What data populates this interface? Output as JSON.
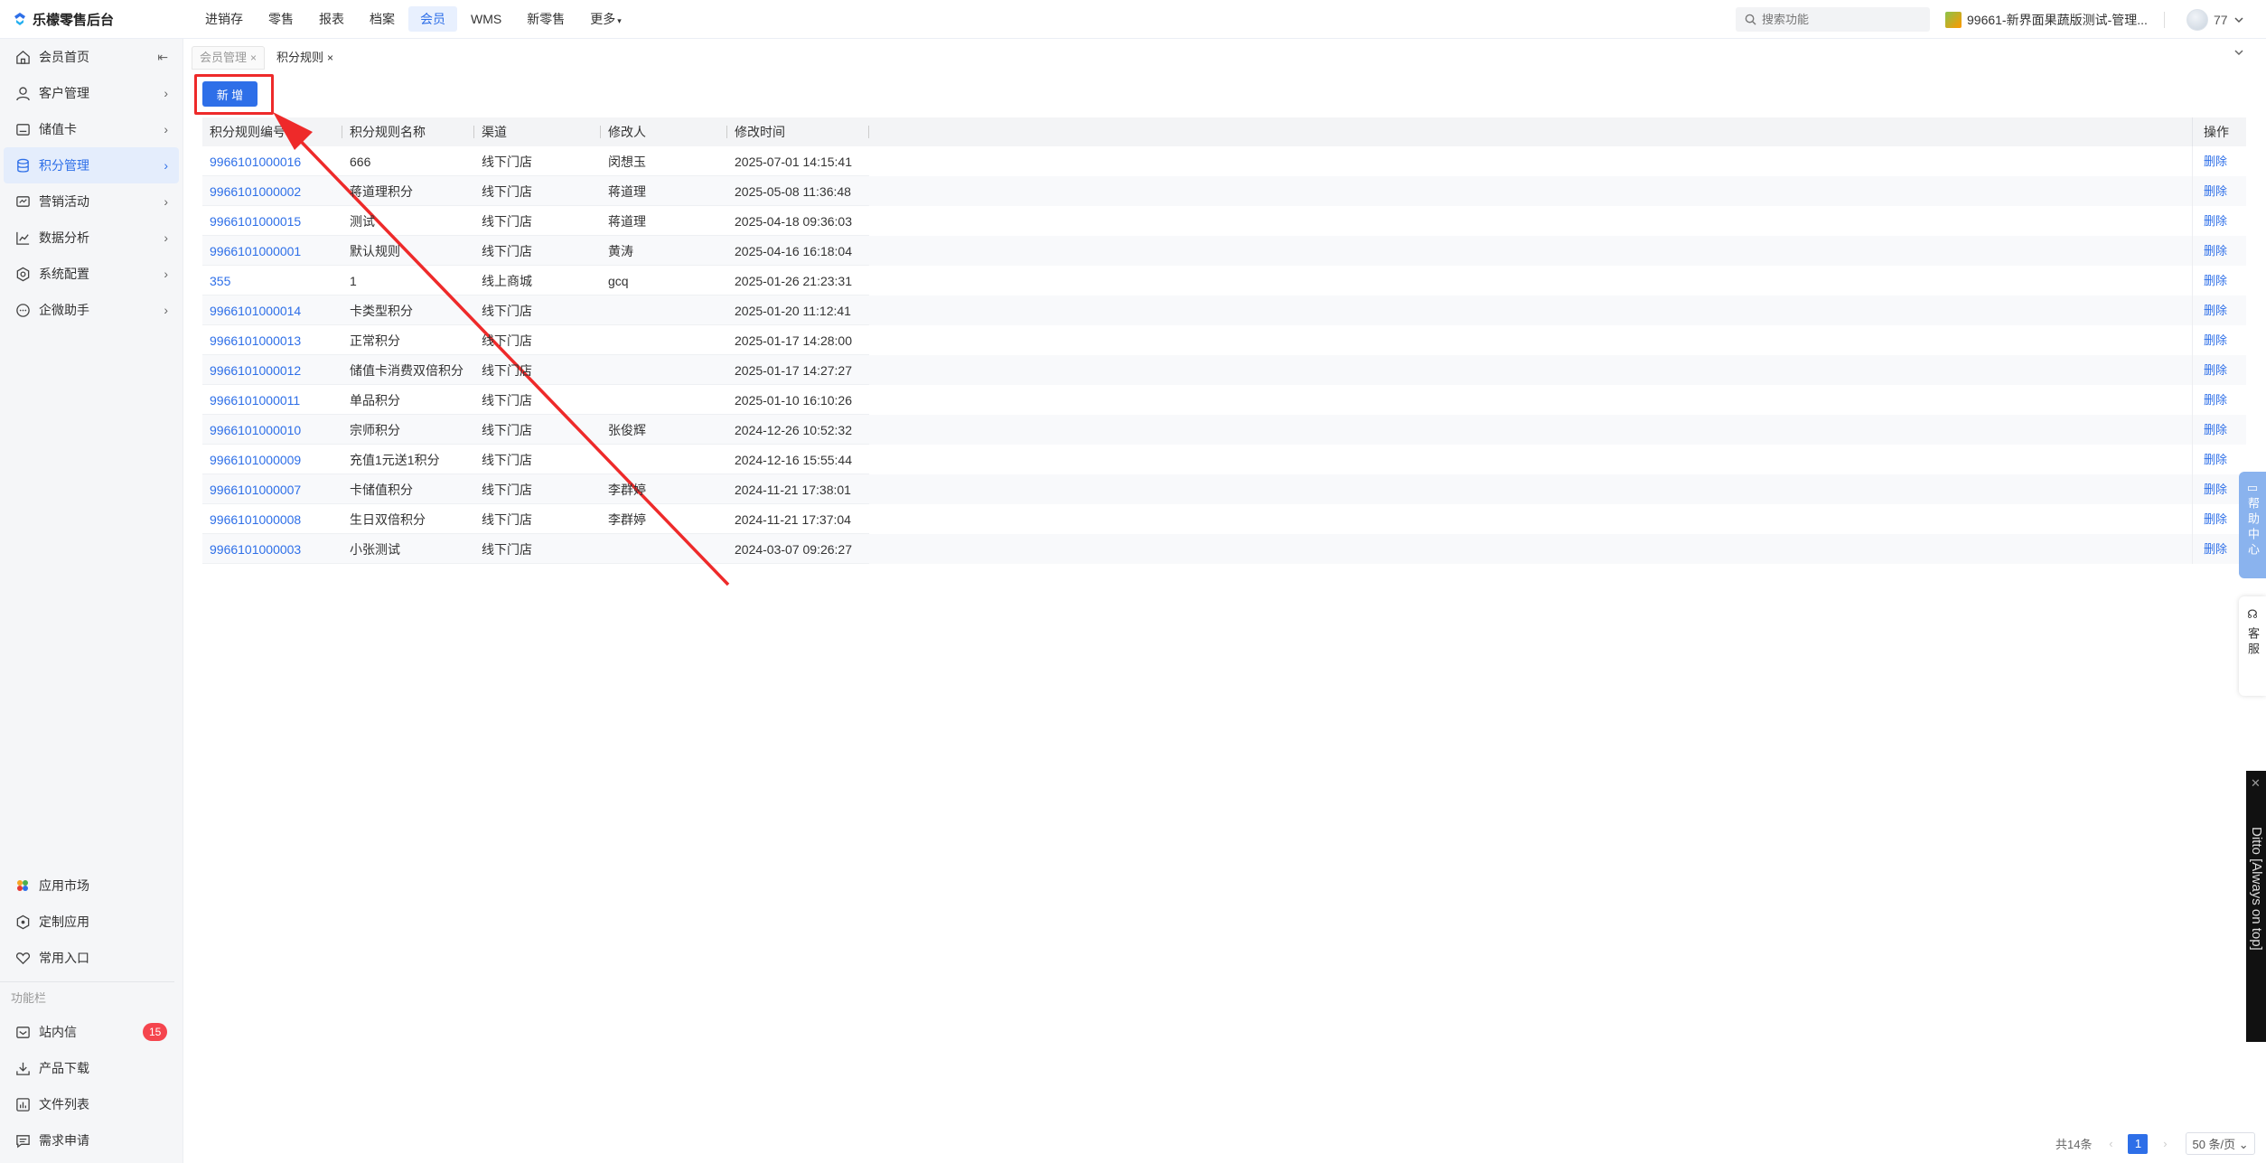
{
  "header": {
    "logo_text": "乐檬零售后台",
    "nav": [
      {
        "label": "进销存"
      },
      {
        "label": "零售"
      },
      {
        "label": "报表"
      },
      {
        "label": "档案"
      },
      {
        "label": "会员"
      },
      {
        "label": "WMS"
      },
      {
        "label": "新零售"
      },
      {
        "label": "更多"
      }
    ],
    "active_nav": "会员",
    "search_placeholder": "搜索功能",
    "store_name": "99661-新界面果蔬版测试-管理...",
    "user_name": "77"
  },
  "sidebar": {
    "items": [
      {
        "label": "会员首页",
        "icon": "home-icon"
      },
      {
        "label": "客户管理",
        "icon": "user-icon"
      },
      {
        "label": "储值卡",
        "icon": "card-icon"
      },
      {
        "label": "积分管理",
        "icon": "database-icon"
      },
      {
        "label": "营销活动",
        "icon": "campaign-icon"
      },
      {
        "label": "数据分析",
        "icon": "chart-icon"
      },
      {
        "label": "系统配置",
        "icon": "settings-icon"
      },
      {
        "label": "企微助手",
        "icon": "chat-icon"
      }
    ],
    "active_item": "积分管理",
    "apps": [
      {
        "label": "应用市场",
        "icon": "app-market-icon"
      },
      {
        "label": "定制应用",
        "icon": "custom-app-icon"
      },
      {
        "label": "常用入口",
        "icon": "heart-icon"
      }
    ],
    "section_label": "功能栏",
    "tools": [
      {
        "label": "站内信",
        "icon": "mail-icon",
        "badge": "15"
      },
      {
        "label": "产品下载",
        "icon": "download-icon"
      },
      {
        "label": "文件列表",
        "icon": "file-list-icon"
      },
      {
        "label": "需求申请",
        "icon": "request-icon"
      }
    ]
  },
  "tabs": [
    {
      "label": "会员管理",
      "active": false
    },
    {
      "label": "积分规则",
      "active": true
    }
  ],
  "toolbar": {
    "add_label": "新 增"
  },
  "table": {
    "columns": [
      "积分规则编号",
      "积分规则名称",
      "渠道",
      "修改人",
      "修改时间"
    ],
    "action_column": "操作",
    "action_label": "删除",
    "rows": [
      {
        "id": "9966101000016",
        "name": "666",
        "channel": "线下门店",
        "editor": "闵想玉",
        "time": "2025-07-01 14:15:41"
      },
      {
        "id": "9966101000002",
        "name": "蒋道理积分",
        "channel": "线下门店",
        "editor": "蒋道理",
        "time": "2025-05-08 11:36:48"
      },
      {
        "id": "9966101000015",
        "name": "测试",
        "channel": "线下门店",
        "editor": "蒋道理",
        "time": "2025-04-18 09:36:03"
      },
      {
        "id": "9966101000001",
        "name": "默认规则",
        "channel": "线下门店",
        "editor": "黄涛",
        "time": "2025-04-16 16:18:04"
      },
      {
        "id": "355",
        "name": "1",
        "channel": "线上商城",
        "editor": "gcq",
        "time": "2025-01-26 21:23:31"
      },
      {
        "id": "9966101000014",
        "name": "卡类型积分",
        "channel": "线下门店",
        "editor": "",
        "time": "2025-01-20 11:12:41"
      },
      {
        "id": "9966101000013",
        "name": "正常积分",
        "channel": "线下门店",
        "editor": "",
        "time": "2025-01-17 14:28:00"
      },
      {
        "id": "9966101000012",
        "name": "储值卡消费双倍积分",
        "channel": "线下门店",
        "editor": "",
        "time": "2025-01-17 14:27:27"
      },
      {
        "id": "9966101000011",
        "name": "单品积分",
        "channel": "线下门店",
        "editor": "",
        "time": "2025-01-10 16:10:26"
      },
      {
        "id": "9966101000010",
        "name": "宗师积分",
        "channel": "线下门店",
        "editor": "张俊辉",
        "time": "2024-12-26 10:52:32"
      },
      {
        "id": "9966101000009",
        "name": "充值1元送1积分",
        "channel": "线下门店",
        "editor": "",
        "time": "2024-12-16 15:55:44"
      },
      {
        "id": "9966101000007",
        "name": "卡储值积分",
        "channel": "线下门店",
        "editor": "李群婷",
        "time": "2024-11-21 17:38:01"
      },
      {
        "id": "9966101000008",
        "name": "生日双倍积分",
        "channel": "线下门店",
        "editor": "李群婷",
        "time": "2024-11-21 17:37:04"
      },
      {
        "id": "9966101000003",
        "name": "小张测试",
        "channel": "线下门店",
        "editor": "",
        "time": "2024-03-07 09:26:27"
      }
    ]
  },
  "pagination": {
    "total": "共14条",
    "current_page": "1",
    "page_size": "50 条/页"
  },
  "float_widgets": {
    "help": "帮助中心",
    "service": "客服",
    "ditto": "Ditto [Always on top]"
  },
  "colors": {
    "accent": "#2e6fe8",
    "annotation": "#ee2a2a",
    "badge": "#f5454e"
  }
}
